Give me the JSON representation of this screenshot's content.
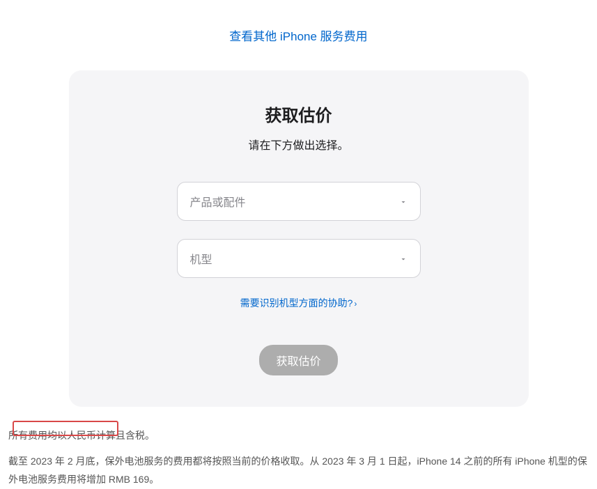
{
  "topLink": {
    "text": "查看其他 iPhone 服务费用"
  },
  "card": {
    "title": "获取估价",
    "subtitle": "请在下方做出选择。",
    "select1": {
      "placeholder": "产品或配件"
    },
    "select2": {
      "placeholder": "机型"
    },
    "helpLink": {
      "text": "需要识别机型方面的协助?"
    },
    "submitButton": {
      "label": "获取估价"
    }
  },
  "footer": {
    "note1": "所有费用均以人民币计算且含税。",
    "note2": "截至 2023 年 2 月底，保外电池服务的费用都将按照当前的价格收取。从 2023 年 3 月 1 日起，iPhone 14 之前的所有 iPhone 机型的保外电池服务费用将增加 RMB 169。"
  }
}
